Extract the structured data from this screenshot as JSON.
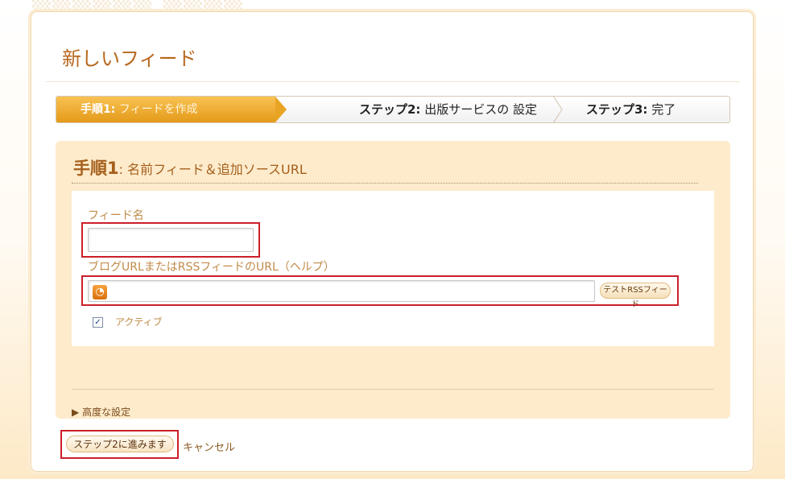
{
  "page": {
    "title": "新しいフィード"
  },
  "steps": {
    "step1": {
      "prefix": "手順1:",
      "label": "フィードを作成"
    },
    "step2": {
      "prefix": "ステップ2:",
      "label": "出版サービスの 設定"
    },
    "step3": {
      "prefix": "ステップ3:",
      "label": "完了"
    }
  },
  "section": {
    "num": "手順1",
    "colon": ":",
    "title": "名前フィード＆追加ソースURL"
  },
  "form": {
    "feed_name_label": "フィード名",
    "feed_name_value": "",
    "url_label": "ブログURLまたはRSSフィードのURL（ヘルプ）",
    "url_value": "",
    "test_button": "テストRSSフィード",
    "active_label": "アクティブ",
    "active_checked": true
  },
  "advanced": {
    "arrow": "▶",
    "label": "高度な設定"
  },
  "actions": {
    "next": "ステップ2に進みます",
    "cancel": "キャンセル"
  },
  "colors": {
    "accent": "#e49a19",
    "title": "#b8671d",
    "highlight": "#cc1f2a",
    "panel": "#fdebcc"
  },
  "icons": {
    "rss": "rss-feed-icon",
    "check": "checkbox-checked-icon",
    "triangle": "triangle-right-icon"
  }
}
